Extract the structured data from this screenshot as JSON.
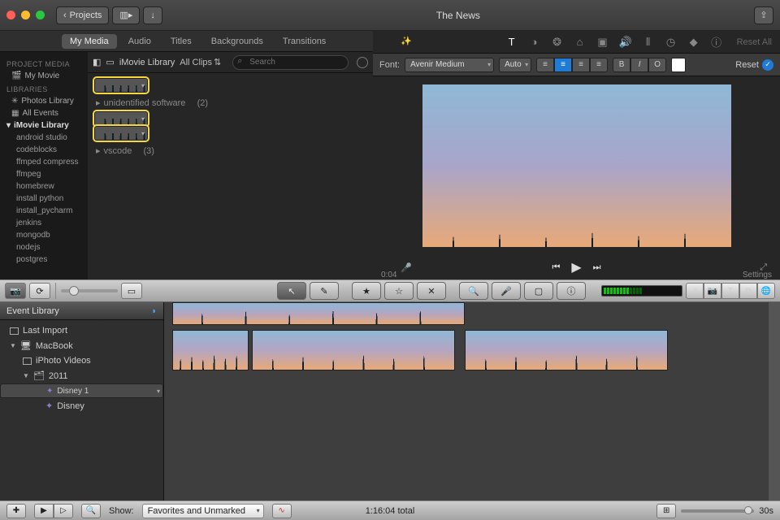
{
  "titlebar": {
    "back_label": "Projects",
    "title": "The News"
  },
  "tabs": {
    "items": [
      "My Media",
      "Audio",
      "Titles",
      "Backgrounds",
      "Transitions"
    ],
    "active": "My Media"
  },
  "sidebar": {
    "project_head": "PROJECT MEDIA",
    "project_item": "My Movie",
    "libraries_head": "LIBRARIES",
    "photos": "Photos Library",
    "all_events": "All Events",
    "imovie_lib": "iMovie Library",
    "events": [
      "android studio",
      "codeblocks",
      "ffmped compress",
      "ffmpeg",
      "homebrew",
      "install python",
      "install_pycharm",
      "jenkins",
      "mongodb",
      "nodejs",
      "postgres"
    ]
  },
  "browser": {
    "title": "iMovie Library",
    "filter": "All Clips",
    "search_placeholder": "Search",
    "group1": {
      "name": "unidentified software",
      "count": "(2)"
    },
    "group2": {
      "name": "vscode",
      "count": "(3)"
    }
  },
  "viewer": {
    "reset_all": "Reset All",
    "font_label": "Font:",
    "font_value": "Avenir Medium",
    "size_value": "Auto",
    "reset": "Reset",
    "timecode": "0:04",
    "settings": "Settings"
  },
  "lower_toolbar": {
    "tools": [
      "pointer",
      "swap",
      "star-fill",
      "star-outline",
      "reject",
      "zoom",
      "mic",
      "crop",
      "info"
    ]
  },
  "event_library": {
    "title": "Event Library",
    "last_import": "Last Import",
    "macbook": "MacBook",
    "iphoto": "iPhoto Videos",
    "year": "2011",
    "disney1": "Disney 1",
    "disney": "Disney"
  },
  "statusbar": {
    "show_label": "Show:",
    "show_value": "Favorites and Unmarked",
    "total": "1:16:04 total",
    "zoom_label": "30s"
  }
}
